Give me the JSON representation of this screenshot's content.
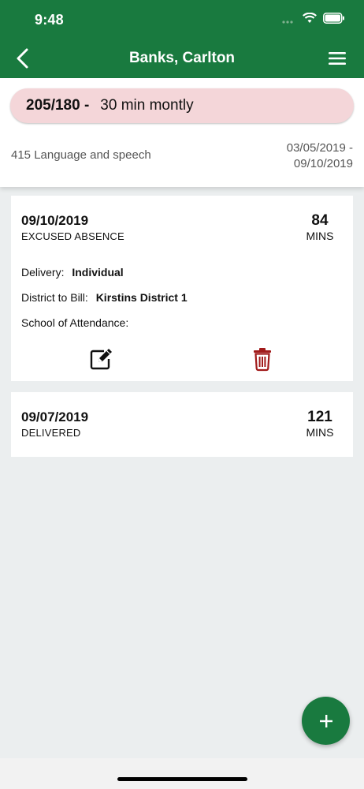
{
  "status_bar": {
    "time": "9:48"
  },
  "nav": {
    "title": "Banks, Carlton"
  },
  "summary": {
    "ratio": "205/180 -",
    "frequency": "30 min montly",
    "service": "415 Language and speech",
    "date_start": "03/05/2019 -",
    "date_end": "09/10/2019"
  },
  "entries": [
    {
      "date": "09/10/2019",
      "status": "EXCUSED ABSENCE",
      "minutes": "84",
      "minutes_unit": "MINS",
      "delivery_label": "Delivery:",
      "delivery_value": "Individual",
      "district_label": "District to Bill:",
      "district_value": "Kirstins District 1",
      "school_label": "School of Attendance:",
      "school_value": ""
    },
    {
      "date": "09/07/2019",
      "status": "DELIVERED",
      "minutes": "121",
      "minutes_unit": "MINS"
    }
  ],
  "colors": {
    "brand_green": "#197a3f",
    "pill_bg": "#f4d6d9",
    "delete_red": "#a11a1a",
    "page_bg": "#ebeeef"
  },
  "icons": [
    "back-chevron-icon",
    "hamburger-menu-icon",
    "edit-icon",
    "trash-icon",
    "plus-icon",
    "wifi-icon",
    "battery-icon",
    "signal-icon"
  ]
}
